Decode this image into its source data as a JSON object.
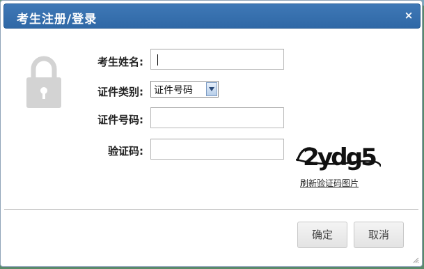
{
  "dialog": {
    "title": "考生注册/登录",
    "close_symbol": "×"
  },
  "form": {
    "name_label": "考生姓名:",
    "name_value": "",
    "id_type_label": "证件类别:",
    "id_type_selected": "证件号码",
    "id_number_label": "证件号码:",
    "id_number_value": "",
    "captcha_label": "验证码:",
    "captcha_value": "",
    "captcha_image_text": "2ydg5",
    "refresh_captcha_link": "刷新验证码图片"
  },
  "buttons": {
    "confirm_label": "确定",
    "cancel_label": "取消"
  },
  "icons": {
    "lock": "lock-icon",
    "close": "close-icon",
    "dropdown": "chevron-down-icon",
    "resize": "resize-grip-icon"
  },
  "colors": {
    "titlebar": "#3470ae",
    "title_text": "#ffffff",
    "lock": "#d3d3d3"
  }
}
